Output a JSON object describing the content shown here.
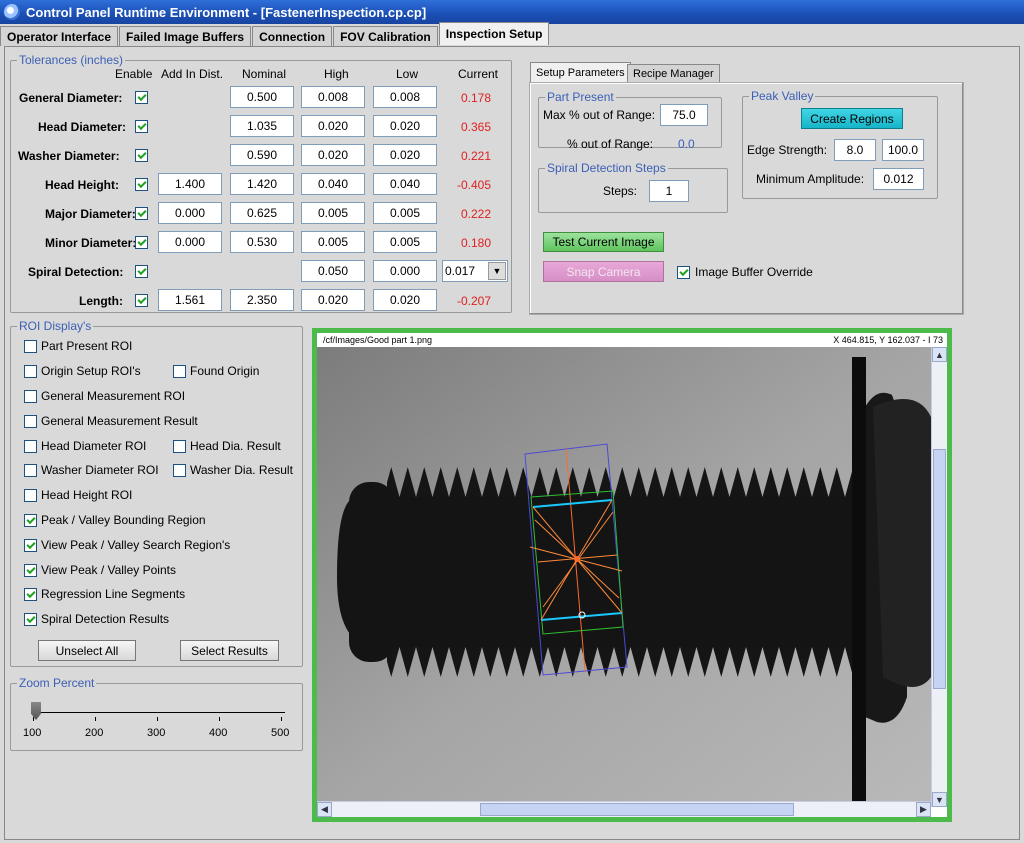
{
  "window": {
    "title": "Control Panel Runtime Environment - [FastenerInspection.cp.cp]"
  },
  "tabs": [
    "Operator Interface",
    "Failed Image Buffers",
    "Connection",
    "FOV Calibration",
    "Inspection Setup"
  ],
  "tolerances": {
    "legend": "Tolerances (inches)",
    "headers": {
      "enable": "Enable",
      "add": "Add In Dist.",
      "nominal": "Nominal",
      "high": "High",
      "low": "Low",
      "current": "Current"
    },
    "rows": [
      {
        "label": "General Diameter:",
        "enabled": true,
        "add": "",
        "nominal": "0.500",
        "high": "0.008",
        "low": "0.008",
        "current": "0.178"
      },
      {
        "label": "Head Diameter:",
        "enabled": true,
        "add": "",
        "nominal": "1.035",
        "high": "0.020",
        "low": "0.020",
        "current": "0.365"
      },
      {
        "label": "Washer Diameter:",
        "enabled": true,
        "add": "",
        "nominal": "0.590",
        "high": "0.020",
        "low": "0.020",
        "current": "0.221"
      },
      {
        "label": "Head Height:",
        "enabled": true,
        "add": "1.400",
        "nominal": "1.420",
        "high": "0.040",
        "low": "0.040",
        "current": "-0.405"
      },
      {
        "label": "Major Diameter:",
        "enabled": true,
        "add": "0.000",
        "nominal": "0.625",
        "high": "0.005",
        "low": "0.005",
        "current": "0.222"
      },
      {
        "label": "Minor Diameter:",
        "enabled": true,
        "add": "0.000",
        "nominal": "0.530",
        "high": "0.005",
        "low": "0.005",
        "current": "0.180"
      },
      {
        "label": "Spiral Detection:",
        "enabled": true,
        "add": "",
        "nominal": "",
        "high": "0.050",
        "low": "0.000",
        "current": "0.017"
      },
      {
        "label": "Length:",
        "enabled": true,
        "add": "1.561",
        "nominal": "2.350",
        "high": "0.020",
        "low": "0.020",
        "current": "-0.207"
      }
    ]
  },
  "setup": {
    "tabs": [
      "Setup Parameters",
      "Recipe Manager"
    ],
    "part_present": {
      "legend": "Part Present",
      "max_label": "Max % out of Range:",
      "max_value": "75.0",
      "pct_label": "% out of Range:",
      "pct_value": "0.0"
    },
    "spiral": {
      "legend": "Spiral Detection Steps",
      "steps_label": "Steps:",
      "steps_value": "1"
    },
    "peak_valley": {
      "legend": "Peak Valley",
      "create_label": "Create Regions",
      "edge_label": "Edge Strength:",
      "edge_value1": "8.0",
      "edge_value2": "100.0",
      "amp_label": "Minimum Amplitude:",
      "amp_value": "0.012"
    },
    "test_label": "Test Current Image",
    "snap_label": "Snap Camera",
    "override_label": "Image Buffer Override",
    "override_checked": true
  },
  "roi": {
    "legend": "ROI Display's",
    "items": [
      {
        "label": "Part Present ROI",
        "checked": false
      },
      {
        "label": "Origin Setup ROI's",
        "checked": false
      },
      {
        "label": "Found Origin",
        "checked": false
      },
      {
        "label": "General Measurement ROI",
        "checked": false
      },
      {
        "label": "General Measurement Result",
        "checked": false
      },
      {
        "label": "Head Diameter ROI",
        "checked": false
      },
      {
        "label": "Head Dia. Result",
        "checked": false
      },
      {
        "label": "Washer Diameter ROI",
        "checked": false
      },
      {
        "label": "Washer Dia. Result",
        "checked": false
      },
      {
        "label": "Head Height ROI",
        "checked": false
      },
      {
        "label": "Peak / Valley Bounding Region",
        "checked": true
      },
      {
        "label": "View Peak / Valley Search Region's",
        "checked": true
      },
      {
        "label": "View Peak / Valley Points",
        "checked": true
      },
      {
        "label": "Regression Line Segments",
        "checked": true
      },
      {
        "label": "Spiral Detection Results",
        "checked": true
      }
    ],
    "unselect_label": "Unselect All",
    "select_label": "Select Results"
  },
  "zoom": {
    "legend": "Zoom Percent",
    "ticks": [
      "100",
      "200",
      "300",
      "400",
      "500"
    ],
    "value_fraction": 0.0
  },
  "viewer": {
    "path": "/cf/Images/Good part 1.png",
    "coords": "X 464.815, Y 162.037 - I 73"
  }
}
